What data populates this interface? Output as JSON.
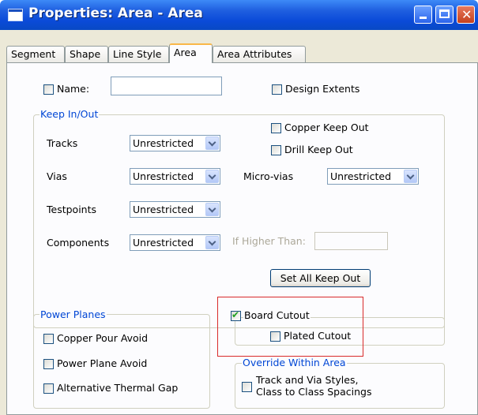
{
  "window": {
    "title": "Properties: Area - Area"
  },
  "tabs": [
    "Segment",
    "Shape",
    "Line Style",
    "Area",
    "Area Attributes"
  ],
  "name_field": {
    "label": "Name:",
    "value": ""
  },
  "design_extents": {
    "label": "Design Extents"
  },
  "keep_in_out": {
    "title": "Keep In/Out",
    "tracks_label": "Tracks",
    "tracks_value": "Unrestricted",
    "vias_label": "Vias",
    "vias_value": "Unrestricted",
    "testpoints_label": "Testpoints",
    "testpoints_value": "Unrestricted",
    "components_label": "Components",
    "components_value": "Unrestricted",
    "micro_vias_label": "Micro-vias",
    "micro_vias_value": "Unrestricted",
    "copper_keep_out": "Copper  Keep Out",
    "drill_keep_out": "Drill  Keep Out",
    "if_higher_than": "If Higher Than:",
    "if_higher_than_value": "",
    "set_all_button": "Set All Keep Out"
  },
  "power_planes": {
    "title": "Power Planes",
    "copper_pour_avoid": "Copper Pour Avoid",
    "power_plane_avoid": "Power Plane Avoid",
    "alt_thermal_gap": "Alternative Thermal Gap"
  },
  "board_cutout": {
    "label": "Board Cutout",
    "checked": true,
    "plated_cutout": "Plated Cutout"
  },
  "override": {
    "title": "Override Within Area",
    "line1": "Track and Via Styles,",
    "line2": "Class to Class Spacings"
  },
  "colors": {
    "titlebar": "#0a4ad8",
    "group_title": "#0046d5",
    "highlight": "#d92b2b",
    "face": "#ece9d8"
  }
}
